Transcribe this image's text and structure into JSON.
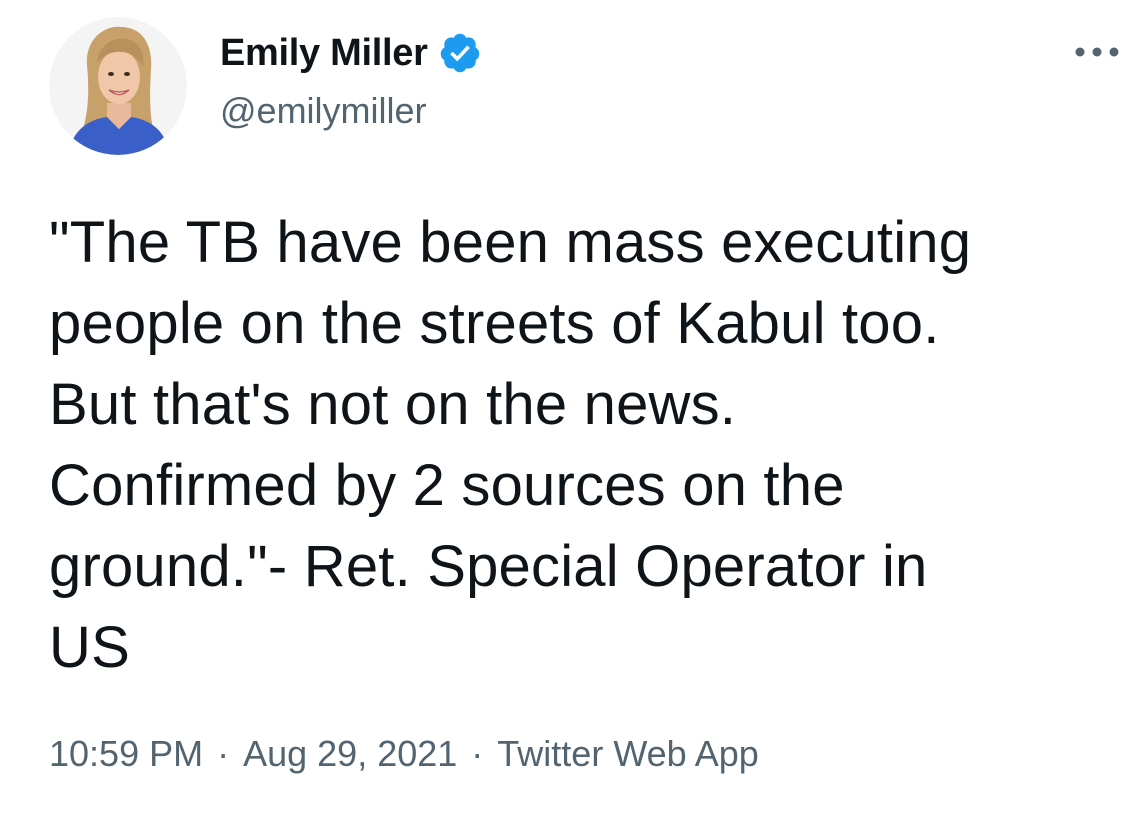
{
  "author": {
    "display_name": "Emily Miller",
    "handle": "@emilymiller",
    "verified": true,
    "avatar_icon": "profile-photo"
  },
  "menu": {
    "icon": "more-icon"
  },
  "tweet": {
    "text": "\"The TB have been mass executing\npeople on the streets of Kabul too.\nBut that's not on the news.\nConfirmed by 2 sources on the\nground.\"- Ret. Special Operator in\nUS"
  },
  "meta": {
    "time": "10:59 PM",
    "separator": "·",
    "date": "Aug 29, 2021",
    "source": "Twitter Web App"
  },
  "colors": {
    "verified_badge": "#1d9bf0",
    "secondary_text": "#536471",
    "primary_text": "#0f1419"
  }
}
